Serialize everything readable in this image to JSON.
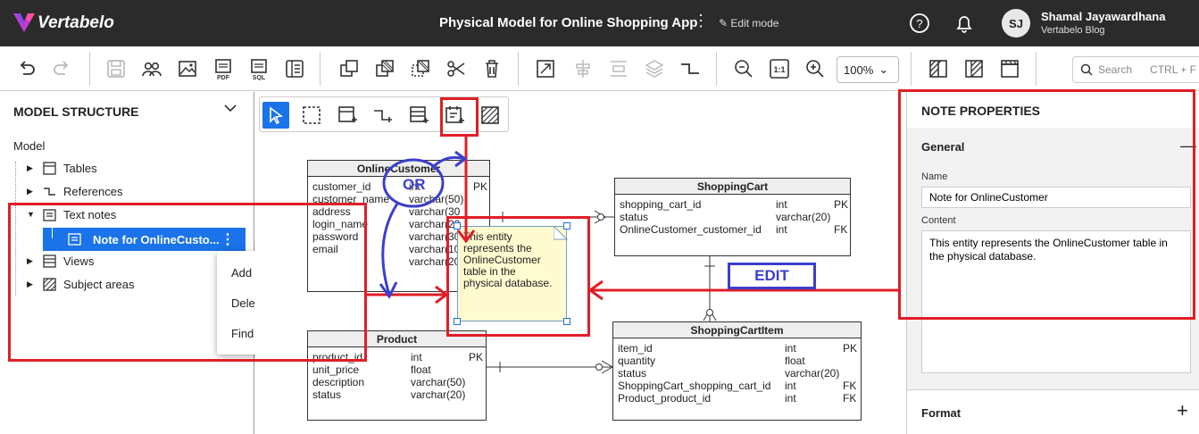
{
  "app": {
    "brand": "Vertabelo",
    "doc_title": "Physical Model for Online Shopping App",
    "edit_mode": "Edit mode",
    "user": {
      "initials": "SJ",
      "name": "Shamal Jayawardhana",
      "subtitle": "Vertabelo Blog"
    }
  },
  "toolbar": {
    "zoom": "100%",
    "search_placeholder": "Search",
    "search_shortcut": "CTRL + F"
  },
  "left_panel": {
    "title": "MODEL STRUCTURE",
    "model_label": "Model",
    "tree": [
      {
        "label": "Tables"
      },
      {
        "label": "References"
      },
      {
        "label": "Text notes"
      },
      {
        "label": "Views"
      },
      {
        "label": "Subject areas"
      }
    ],
    "selected_note": "Note for OnlineCusto...",
    "context_menu": [
      "Add note",
      "Delete note",
      "Find in diagram"
    ]
  },
  "right_panel": {
    "title": "NOTE PROPERTIES",
    "section_general": "General",
    "name_label": "Name",
    "name_value": "Note for OnlineCustomer",
    "content_label": "Content",
    "content_value": "This entity represents the OnlineCustomer table in the physical database.",
    "section_format": "Format"
  },
  "diagram": {
    "tables": {
      "online_customer": {
        "title": "OnlineCustomer",
        "rows": [
          {
            "name": "customer_id",
            "type": "int",
            "key": "PK"
          },
          {
            "name": "customer_name",
            "type": "varchar(50)",
            "key": ""
          },
          {
            "name": "address",
            "type": "varchar(30",
            "key": ""
          },
          {
            "name": "login_name",
            "type": "varchar(20",
            "key": ""
          },
          {
            "name": "password",
            "type": "varchar(30",
            "key": ""
          },
          {
            "name": "email",
            "type": "varchar(10",
            "key": ""
          },
          {
            "name": "",
            "type": "varchar(20",
            "key": ""
          }
        ]
      },
      "shopping_cart": {
        "title": "ShoppingCart",
        "rows": [
          {
            "name": "shopping_cart_id",
            "type": "int",
            "key": "PK"
          },
          {
            "name": "status",
            "type": "varchar(20)",
            "key": ""
          },
          {
            "name": "OnlineCustomer_customer_id",
            "type": "int",
            "key": "FK"
          }
        ]
      },
      "product": {
        "title": "Product",
        "rows": [
          {
            "name": "product_id",
            "type": "int",
            "key": "PK"
          },
          {
            "name": "unit_price",
            "type": "float",
            "key": ""
          },
          {
            "name": "description",
            "type": "varchar(50)",
            "key": ""
          },
          {
            "name": "status",
            "type": "varchar(20)",
            "key": ""
          }
        ]
      },
      "shopping_cart_item": {
        "title": "ShoppingCartItem",
        "rows": [
          {
            "name": "item_id",
            "type": "int",
            "key": "PK"
          },
          {
            "name": "quantity",
            "type": "float",
            "key": ""
          },
          {
            "name": "status",
            "type": "varchar(20)",
            "key": ""
          },
          {
            "name": "ShoppingCart_shopping_cart_id",
            "type": "int",
            "key": "FK"
          },
          {
            "name": "Product_product_id",
            "type": "int",
            "key": "FK"
          }
        ]
      }
    },
    "note_lines": [
      "This entity",
      "represents the",
      "OnlineCustomer",
      "table in the",
      "physical database."
    ]
  },
  "annotations": {
    "or_label": "OR",
    "edit_label": "EDIT"
  },
  "colors": {
    "accent": "#1a73e8",
    "annotation_red": "#e01e26",
    "annotation_blue": "#3b3fcb",
    "note_fill": "#fffbd0",
    "topbar": "#2b2b2b"
  }
}
